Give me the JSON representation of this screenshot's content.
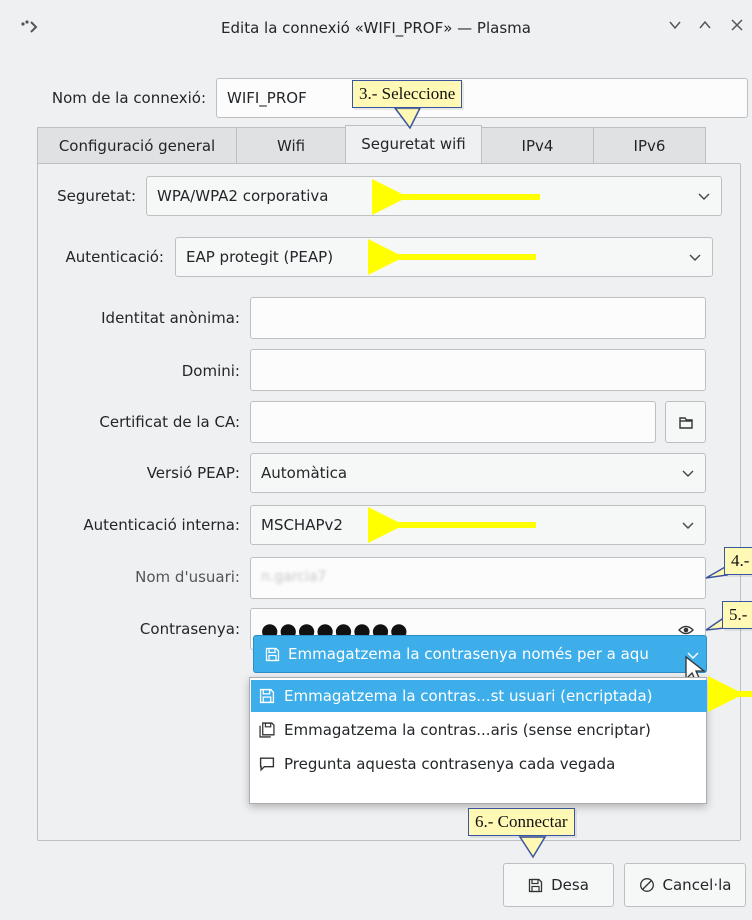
{
  "window": {
    "title": "Edita la connexió «WIFI_PROF» — Plasma",
    "controls": [
      "minimize",
      "maximize",
      "close"
    ]
  },
  "connection_name": {
    "label": "Nom de la connexió:",
    "value": "WIFI_PROF"
  },
  "tabs": [
    {
      "label": "Configuració general",
      "active": false
    },
    {
      "label": "Wifi",
      "active": false
    },
    {
      "label": "Seguretat wifi",
      "active": true
    },
    {
      "label": "IPv4",
      "active": false
    },
    {
      "label": "IPv6",
      "active": false
    }
  ],
  "security": {
    "label": "Seguretat:",
    "value": "WPA/WPA2 corporativa"
  },
  "authentication": {
    "label": "Autenticació:",
    "value": "EAP protegit (PEAP)"
  },
  "fields": {
    "anon_identity": {
      "label": "Identitat anònima:",
      "value": ""
    },
    "domain": {
      "label": "Domini:",
      "value": ""
    },
    "ca_cert": {
      "label": "Certificat de la CA:",
      "value": ""
    },
    "peap_version": {
      "label": "Versió PEAP:",
      "value": "Automàtica"
    },
    "inner_auth": {
      "label": "Autenticació interna:",
      "value": "MSCHAPv2"
    },
    "username": {
      "label": "Nom d'usuari:",
      "value": "n.garcia7"
    },
    "password": {
      "label": "Contrasenya:",
      "value": "●●●●●●●●"
    }
  },
  "password_storage": {
    "current": "Emmagatzema la contrasenya només per a aqu",
    "options": [
      "Emmagatzema la contras...st usuari (encriptada)",
      "Emmagatzema la contras...aris (sense encriptar)",
      "Pregunta aquesta contrasenya cada vegada"
    ],
    "selected_index": 0
  },
  "buttons": {
    "save": "Desa",
    "cancel": "Cancel·la"
  },
  "annotations": {
    "callout_3": "3.- Seleccione",
    "callout_4": "4.-",
    "callout_5": "5.-",
    "callout_6": "6.- Connectar",
    "arrow_color": "#ffff00",
    "callout_fill": "#fff9b5",
    "callout_border": "#3a55a0"
  },
  "colors": {
    "window_bg": "#eff0f1",
    "accent": "#3daee9"
  }
}
